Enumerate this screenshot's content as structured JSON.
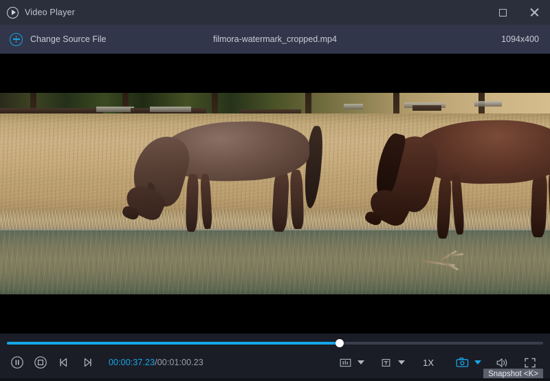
{
  "window": {
    "title": "Video Player",
    "app_icon": "play-circle-icon",
    "maximize_icon": "maximize-icon",
    "close_icon": "close-icon"
  },
  "source_bar": {
    "add_icon": "plus-circle-icon",
    "change_source_label": "Change Source File",
    "filename": "filmora-watermark_cropped.mp4",
    "resolution": "1094x400"
  },
  "player": {
    "progress_percent": 62,
    "current_time": "00:00:37.23",
    "separator": "/",
    "total_time": "00:01:00.23",
    "speed_label": "1X",
    "buttons": {
      "pause": "pause-icon",
      "stop": "stop-icon",
      "prev_frame": "step-backward-icon",
      "next_frame": "step-forward-icon",
      "equalizer": "equalizer-icon",
      "subtitle": "subtitle-text-icon",
      "snapshot": "camera-icon",
      "volume": "volume-icon",
      "fullscreen": "fullscreen-icon"
    },
    "tooltip": "Snapshot <K>"
  },
  "colors": {
    "accent": "#16a7e8",
    "titlebar_bg": "#2b2e3b",
    "sourcebar_bg": "#32364a",
    "controls_bg": "#1b1d26",
    "text": "#c9ccd6"
  },
  "video": {
    "scene_description": "Two horses drinking at a pond"
  }
}
